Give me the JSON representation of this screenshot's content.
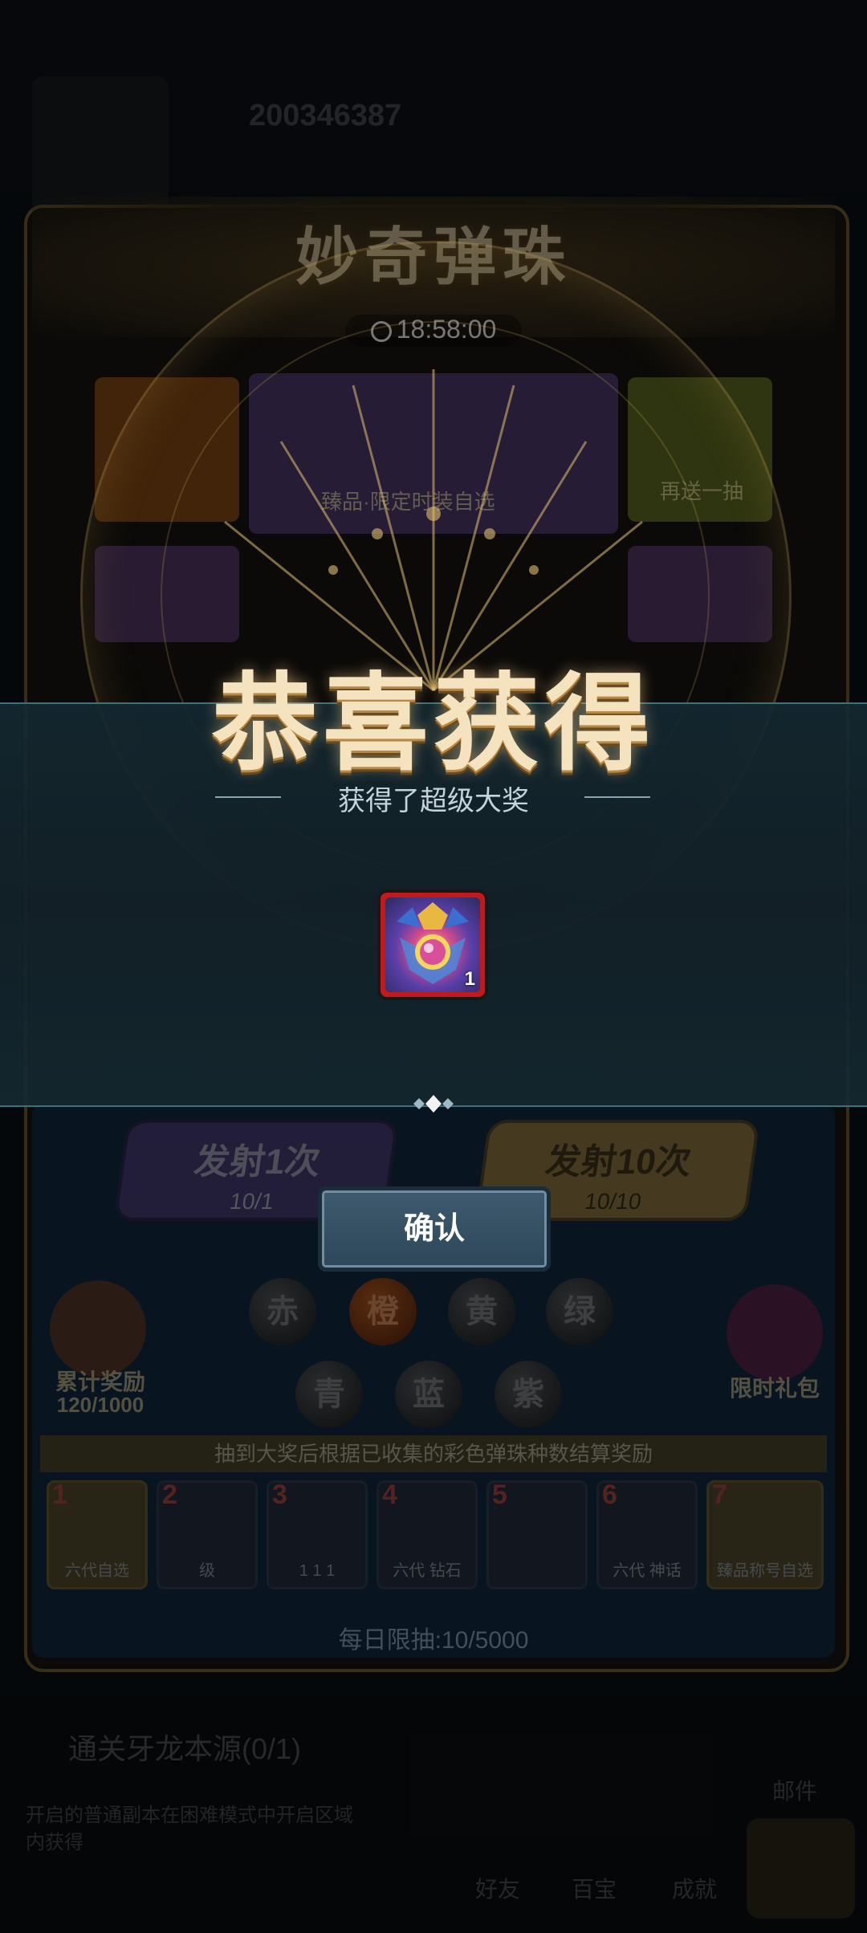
{
  "background": {
    "player_id": "200346387",
    "event_title": "妙奇弹珠",
    "timer": "18:58:00",
    "banner_caption": "臻品·限定时装自选",
    "resend_label": "再送一抽",
    "fire_once": {
      "label": "发射1次",
      "cost": "10/1"
    },
    "fire_ten": {
      "label": "发射10次",
      "cost": "10/10"
    },
    "balls": [
      "赤",
      "橙",
      "黄",
      "绿",
      "青",
      "蓝",
      "紫"
    ],
    "accumulate": {
      "label": "累计奖励",
      "progress": "120/1000"
    },
    "gift_label": "限时礼包",
    "tip": "抽到大奖后根据已收集的彩色弹珠种数结算奖励",
    "reward_slots": [
      {
        "num": "1",
        "caption": "六代自选"
      },
      {
        "num": "2",
        "caption": "级"
      },
      {
        "num": "3",
        "caption": "1 1 1"
      },
      {
        "num": "4",
        "caption": "六代 钻石"
      },
      {
        "num": "5",
        "caption": ""
      },
      {
        "num": "6",
        "caption": "六代 神话"
      },
      {
        "num": "7",
        "caption": "臻品称号自选"
      }
    ],
    "daily_limit": "每日限抽:10/5000",
    "task": "通关牙龙本源(0/1)",
    "task_desc_1": "开启的普通副本在困难模式中开启区域",
    "task_desc_2": "内获得",
    "nav": {
      "friends": "好友",
      "guild": "百宝",
      "achievement": "成就",
      "mail": "邮件"
    }
  },
  "dialog": {
    "title": "恭喜获得",
    "subtitle": "获得了超级大奖",
    "item": {
      "icon": "super-prize-badge-icon",
      "count": "1"
    },
    "confirm_label": "确认"
  },
  "colors": {
    "dialog_band": "#142830",
    "title_gold": "#f4e3be",
    "item_border": "#c21a1a",
    "confirm_bg": "#3f5a6e"
  }
}
